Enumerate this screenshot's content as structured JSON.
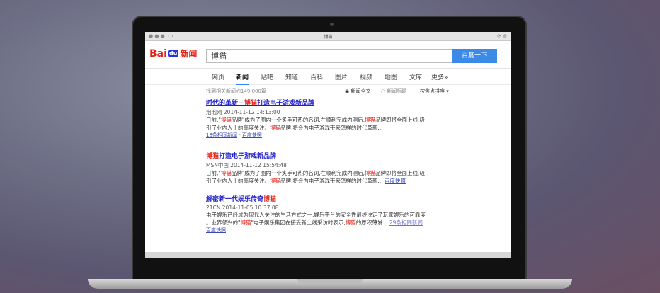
{
  "browser": {
    "title": "博猫"
  },
  "logo": {
    "bai": "Bai",
    "du": "du",
    "news": "新闻"
  },
  "search": {
    "value": "博猫",
    "button": "百度一下"
  },
  "nav": [
    "网页",
    "新闻",
    "贴吧",
    "知道",
    "百科",
    "图片",
    "视频",
    "地图",
    "文库",
    "更多»"
  ],
  "nav_active": "新闻",
  "options": {
    "count": "找到相关新闻约149,000篇",
    "full_text": "新闻全文",
    "title_only": "新闻标题",
    "sort": "按焦点排序"
  },
  "results": [
    {
      "title_a": "时代的革新—",
      "title_hl": "博猫",
      "title_b": "打造电子游戏新品牌",
      "meta": "泡泡网  2014-11-12 14:13:00",
      "desc1_a": "日前,\"",
      "desc1_hl": "博猫",
      "desc1_b": "品牌\"成为了圈内一个炙手可热的名词,在顺利完成内测后,",
      "desc1_hl2": "博猫",
      "desc1_c": "品牌即将全面上线,吸",
      "desc2_a": "引了业内人士的高度关注。",
      "desc2_hl": "博猫",
      "desc2_b": "品牌,将会为电子游戏带来怎样的时代革新...",
      "link1": "18条相同新闻",
      "link2": "百度快照"
    },
    {
      "title_hl": "博猫",
      "title_b": "打造电子游戏新品牌",
      "meta": "MSN中国  2014-11-12 15:54:48",
      "desc1_a": "日前,\"",
      "desc1_hl": "博猫",
      "desc1_b": "品牌\"成为了圈内一个炙手可热的名词,在顺利完成内测后,",
      "desc1_hl2": "博猫",
      "desc1_c": "品牌即将全面上线,吸",
      "desc2_a": "引了业内人士的高度关注。",
      "desc2_hl": "博猫",
      "desc2_b": "品牌,将会为电子游戏带来怎样的时代革新...",
      "link2": "百度快照"
    },
    {
      "title_a": "解密新一代娱乐传奇",
      "title_hl": "博猫",
      "meta": "21CN  2014-11-05 10:37:08",
      "desc1_a": "电子娱乐已经成为现代人关注的生活方式之一,娱乐平台的安全性最终决定了玩家娱乐的可靠度",
      "desc2_a": "。业界领兴的\"",
      "desc2_hl": "博猫",
      "desc2_b": "\"电子娱乐集团在接受新上线采访时表示,",
      "desc2_hl2": "博猫",
      "desc2_c": "的厚积薄发...",
      "link1": "29条相同新闻",
      "link2": "百度快照"
    }
  ]
}
